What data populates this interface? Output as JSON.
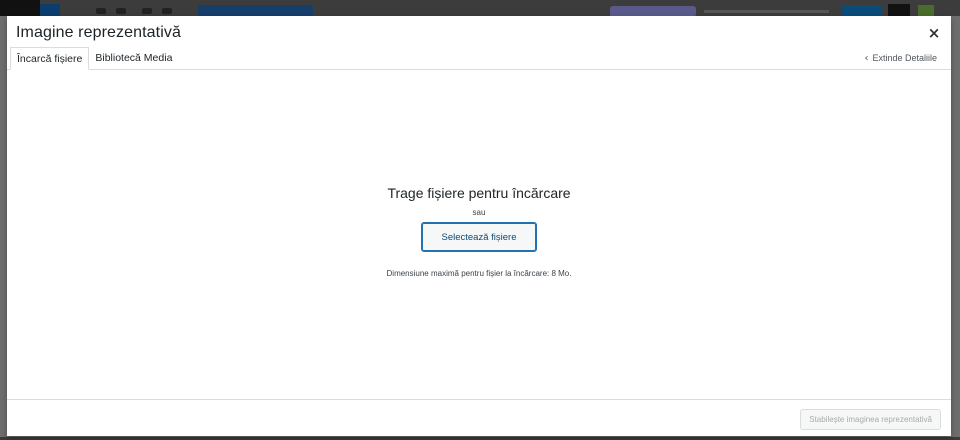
{
  "modal": {
    "title": "Imagine reprezentativă",
    "close_glyph": "×",
    "tabs": [
      {
        "label": "Încarcă fișiere",
        "active": true
      },
      {
        "label": "Bibliotecă Media",
        "active": false
      }
    ],
    "expand_details": "Extinde Detaliile"
  },
  "uploader": {
    "drop_text": "Trage fișiere pentru încărcare",
    "or_text": "sau",
    "select_button": "Selectează fișiere",
    "max_size_text": "Dimensiune maximă pentru fișier la încărcare: 8 Mo."
  },
  "toolbar": {
    "set_featured_button": "Stabilește imaginea reprezentativă",
    "set_featured_disabled": true
  },
  "colors": {
    "accent": "#2271b1",
    "overlay": "#6e6e6e"
  },
  "icons": {
    "close": "close-icon",
    "expand": "chevron-left-icon"
  }
}
